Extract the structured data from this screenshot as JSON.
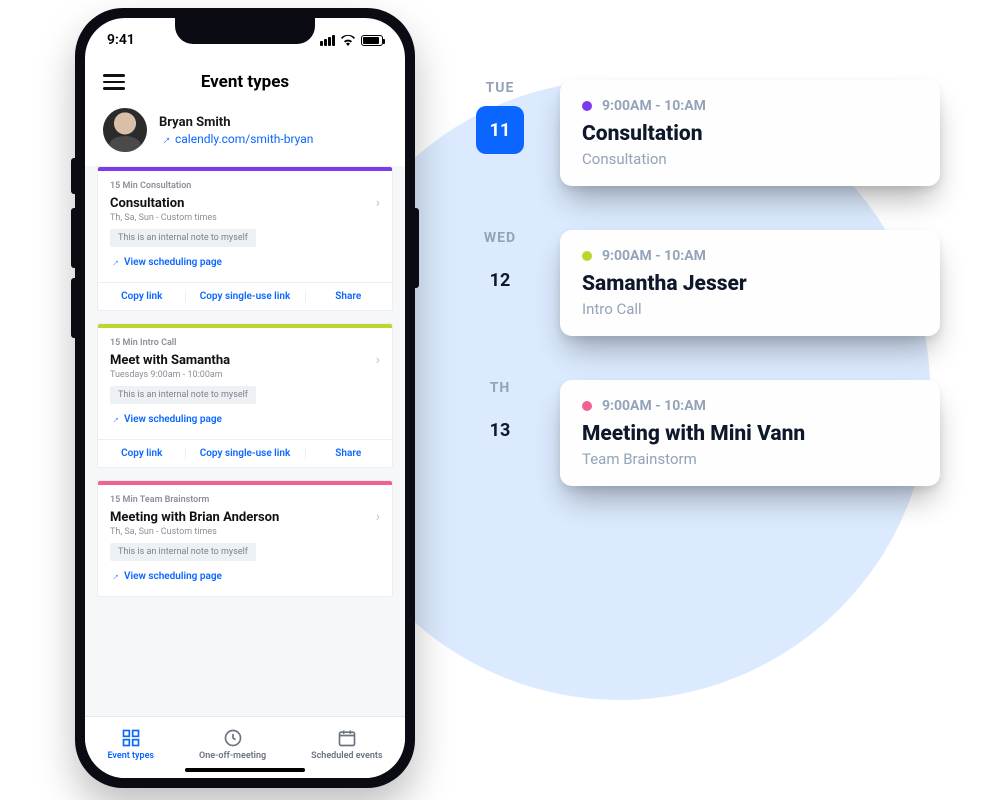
{
  "status": {
    "time": "9:41"
  },
  "header": {
    "title": "Event types"
  },
  "profile": {
    "name": "Bryan Smith",
    "link": "calendly.com/smith-bryan"
  },
  "cards": [
    {
      "color": "#7c3aed",
      "meta": "15 Min Consultation",
      "title": "Consultation",
      "sub": "Th, Sa, Sun - Custom times",
      "note": "This is an internal note to myself",
      "view": "View scheduling page",
      "a1": "Copy link",
      "a2": "Copy single-use link",
      "a3": "Share"
    },
    {
      "color": "#bbd62e",
      "meta": "15 Min Intro Call",
      "title": "Meet with Samantha",
      "sub": "Tuesdays 9:00am - 10:00am",
      "note": "This is an internal note to myself",
      "view": "View scheduling page",
      "a1": "Copy link",
      "a2": "Copy single-use link",
      "a3": "Share"
    },
    {
      "color": "#f06292",
      "meta": "15 Min Team Brainstorm",
      "title": "Meeting with Brian Anderson",
      "sub": "Th, Sa, Sun - Custom times",
      "note": "This is an internal note to myself",
      "view": "View scheduling page",
      "a1": "Copy link",
      "a2": "Copy single-use link",
      "a3": "Share"
    }
  ],
  "tabs": {
    "eventTypes": "Event types",
    "oneOff": "One-off-meeting",
    "scheduled": "Scheduled events"
  },
  "schedule": [
    {
      "dow": "TUE",
      "day": "11",
      "active": true,
      "color": "#7c3aed",
      "time": "9:00AM - 10:AM",
      "title": "Consultation",
      "sub": "Consultation"
    },
    {
      "dow": "WED",
      "day": "12",
      "active": false,
      "color": "#bbd62e",
      "time": "9:00AM - 10:AM",
      "title": "Samantha Jesser",
      "sub": "Intro Call"
    },
    {
      "dow": "TH",
      "day": "13",
      "active": false,
      "color": "#f06292",
      "time": "9:00AM - 10:AM",
      "title": "Meeting with Mini Vann",
      "sub": "Team Brainstorm"
    }
  ]
}
